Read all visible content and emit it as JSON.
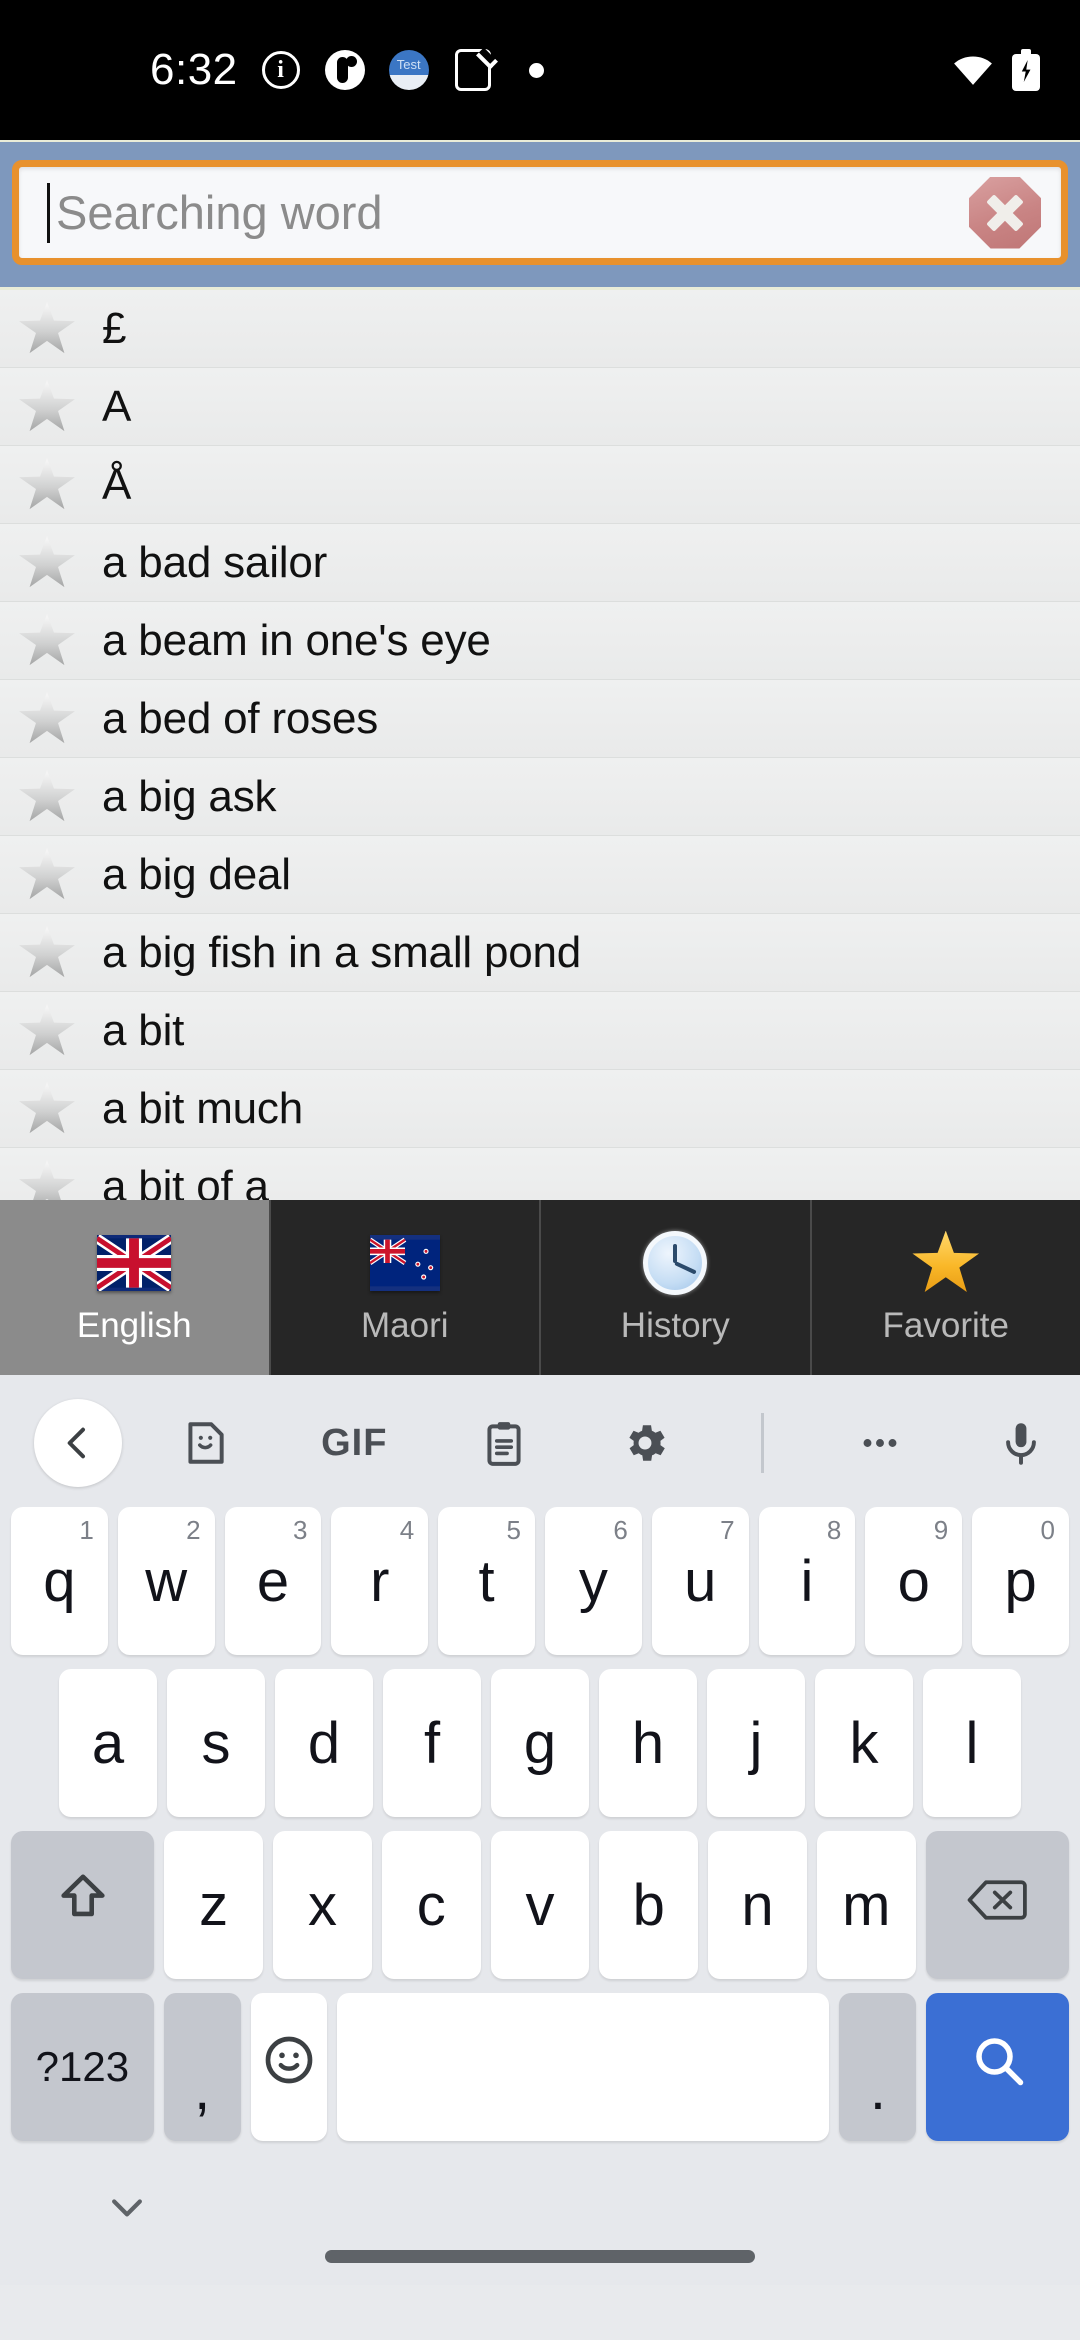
{
  "status_bar": {
    "time": "6:32",
    "notification_icons": [
      "info-icon",
      "badge-icon",
      "test-app-icon",
      "phone-check-icon",
      "dot-icon"
    ],
    "right_icons": [
      "wifi-icon",
      "battery-charging-icon"
    ],
    "test_app_label": "Test"
  },
  "search": {
    "placeholder": "Searching word",
    "value": "",
    "clear_icon": "clear-octagon-icon",
    "border_color": "#e8912d",
    "header_color": "#7e98bd"
  },
  "word_list": {
    "entries": [
      {
        "word": "£",
        "favorite_icon": "star-outline-icon"
      },
      {
        "word": "A",
        "favorite_icon": "star-outline-icon"
      },
      {
        "word": "Å",
        "favorite_icon": "star-outline-icon"
      },
      {
        "word": "a bad sailor",
        "favorite_icon": "star-outline-icon"
      },
      {
        "word": "a beam in one's eye",
        "favorite_icon": "star-outline-icon"
      },
      {
        "word": "a bed of roses",
        "favorite_icon": "star-outline-icon"
      },
      {
        "word": "a big ask",
        "favorite_icon": "star-outline-icon"
      },
      {
        "word": "a big deal",
        "favorite_icon": "star-outline-icon"
      },
      {
        "word": "a big fish in a small pond",
        "favorite_icon": "star-outline-icon"
      },
      {
        "word": "a bit",
        "favorite_icon": "star-outline-icon"
      },
      {
        "word": "a bit much",
        "favorite_icon": "star-outline-icon"
      },
      {
        "word": "a bit of a",
        "favorite_icon": "star-outline-icon"
      }
    ]
  },
  "tabs": [
    {
      "label": "English",
      "icon": "flag-uk-icon",
      "active": true
    },
    {
      "label": "Maori",
      "icon": "flag-nz-icon",
      "active": false
    },
    {
      "label": "History",
      "icon": "clock-icon",
      "active": false
    },
    {
      "label": "Favorite",
      "icon": "gold-star-icon",
      "active": false
    }
  ],
  "keyboard": {
    "toolbar": [
      "back-chevron-icon",
      "sticker-icon",
      "gif-icon",
      "clipboard-icon",
      "settings-gear-icon",
      "divider",
      "overflow-dots-icon",
      "microphone-icon"
    ],
    "gif_label": "GIF",
    "row1": [
      {
        "key": "q",
        "hint": "1"
      },
      {
        "key": "w",
        "hint": "2"
      },
      {
        "key": "e",
        "hint": "3"
      },
      {
        "key": "r",
        "hint": "4"
      },
      {
        "key": "t",
        "hint": "5"
      },
      {
        "key": "y",
        "hint": "6"
      },
      {
        "key": "u",
        "hint": "7"
      },
      {
        "key": "i",
        "hint": "8"
      },
      {
        "key": "o",
        "hint": "9"
      },
      {
        "key": "p",
        "hint": "0"
      }
    ],
    "row2": [
      {
        "key": "a"
      },
      {
        "key": "s"
      },
      {
        "key": "d"
      },
      {
        "key": "f"
      },
      {
        "key": "g"
      },
      {
        "key": "h"
      },
      {
        "key": "j"
      },
      {
        "key": "k"
      },
      {
        "key": "l"
      }
    ],
    "row3": [
      {
        "key": "z"
      },
      {
        "key": "x"
      },
      {
        "key": "c"
      },
      {
        "key": "v"
      },
      {
        "key": "b"
      },
      {
        "key": "n"
      },
      {
        "key": "m"
      }
    ],
    "shift_icon": "shift-arrow-icon",
    "backspace_icon": "backspace-icon",
    "symbols_label": "?123",
    "comma_label": ",",
    "emoji_icon": "emoji-smiley-icon",
    "space_label": "",
    "period_label": ".",
    "search_key_icon": "search-magnifier-icon",
    "search_key_color": "#3b6fd4",
    "hide_keyboard_icon": "chevron-down-icon"
  }
}
